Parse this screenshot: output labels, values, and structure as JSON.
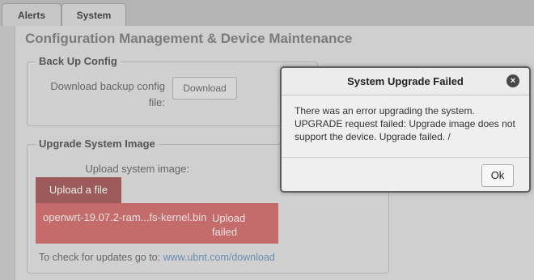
{
  "tabs": [
    {
      "label": "Alerts"
    },
    {
      "label": "System"
    }
  ],
  "page": {
    "title": "Configuration Management & Device Maintenance"
  },
  "backup": {
    "legend": "Back Up Config",
    "label": "Download backup config file:",
    "download_button": "Download"
  },
  "upgrade": {
    "legend": "Upgrade System Image",
    "label": "Upload system image:",
    "upload_button": "Upload a file",
    "file_name": "openwrt-19.07.2-ram...fs-kernel.bin",
    "file_status": "Upload failed",
    "check_text": "To check for updates go to:",
    "check_link": "www.ubnt.com/download"
  },
  "modal": {
    "title": "System Upgrade Failed",
    "close_icon": "×",
    "message": "There was an error upgrading the system. UPGRADE request failed: Upgrade image does not support the device. Upgrade failed. /",
    "ok_button": "Ok"
  },
  "colors": {
    "error_bar": "#c46b6b",
    "upload_button": "#9c5a5a",
    "link": "#6a8bb0"
  }
}
